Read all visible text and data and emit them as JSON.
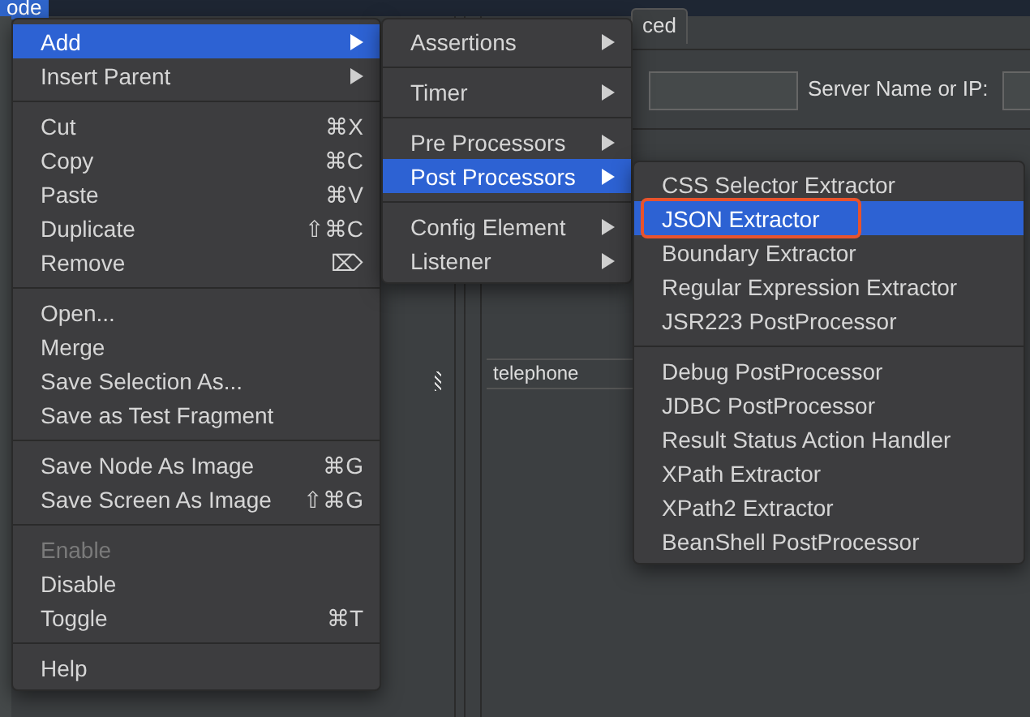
{
  "background": {
    "tree_node": "ode",
    "tab": "ced",
    "server_label": "Server Name or IP:",
    "table_cell": "telephone"
  },
  "menus": [
    {
      "items": [
        {
          "kind": "item",
          "label": "Add",
          "submenu": true,
          "selected": true,
          "disabled": false
        },
        {
          "kind": "item",
          "label": "Insert Parent",
          "submenu": true,
          "selected": false,
          "disabled": false
        },
        {
          "kind": "separator"
        },
        {
          "kind": "item",
          "label": "Cut",
          "shortcut": "⌘X",
          "selected": false,
          "disabled": false
        },
        {
          "kind": "item",
          "label": "Copy",
          "shortcut": "⌘C",
          "selected": false,
          "disabled": false
        },
        {
          "kind": "item",
          "label": "Paste",
          "shortcut": "⌘V",
          "selected": false,
          "disabled": false
        },
        {
          "kind": "item",
          "label": "Duplicate",
          "shortcut": "⇧⌘C",
          "selected": false,
          "disabled": false
        },
        {
          "kind": "item",
          "label": "Remove",
          "shortcut": "⌦",
          "selected": false,
          "disabled": false
        },
        {
          "kind": "separator"
        },
        {
          "kind": "item",
          "label": "Open...",
          "selected": false,
          "disabled": false
        },
        {
          "kind": "item",
          "label": "Merge",
          "selected": false,
          "disabled": false
        },
        {
          "kind": "item",
          "label": "Save Selection As...",
          "selected": false,
          "disabled": false
        },
        {
          "kind": "item",
          "label": "Save as Test Fragment",
          "selected": false,
          "disabled": false
        },
        {
          "kind": "separator"
        },
        {
          "kind": "item",
          "label": "Save Node As Image",
          "shortcut": "⌘G",
          "selected": false,
          "disabled": false
        },
        {
          "kind": "item",
          "label": "Save Screen As Image",
          "shortcut": "⇧⌘G",
          "selected": false,
          "disabled": false
        },
        {
          "kind": "separator"
        },
        {
          "kind": "item",
          "label": "Enable",
          "selected": false,
          "disabled": true
        },
        {
          "kind": "item",
          "label": "Disable",
          "selected": false,
          "disabled": false
        },
        {
          "kind": "item",
          "label": "Toggle",
          "shortcut": "⌘T",
          "selected": false,
          "disabled": false
        },
        {
          "kind": "separator"
        },
        {
          "kind": "item",
          "label": "Help",
          "selected": false,
          "disabled": false
        }
      ]
    },
    {
      "items": [
        {
          "kind": "item",
          "label": "Assertions",
          "submenu": true,
          "selected": false,
          "disabled": false
        },
        {
          "kind": "separator"
        },
        {
          "kind": "item",
          "label": "Timer",
          "submenu": true,
          "selected": false,
          "disabled": false
        },
        {
          "kind": "separator"
        },
        {
          "kind": "item",
          "label": "Pre Processors",
          "submenu": true,
          "selected": false,
          "disabled": false
        },
        {
          "kind": "item",
          "label": "Post Processors",
          "submenu": true,
          "selected": true,
          "disabled": false
        },
        {
          "kind": "separator"
        },
        {
          "kind": "item",
          "label": "Config Element",
          "submenu": true,
          "selected": false,
          "disabled": false
        },
        {
          "kind": "item",
          "label": "Listener",
          "submenu": true,
          "selected": false,
          "disabled": false
        }
      ]
    },
    {
      "items": [
        {
          "kind": "item",
          "label": "CSS Selector Extractor",
          "selected": false,
          "disabled": false
        },
        {
          "kind": "item",
          "label": "JSON Extractor",
          "selected": true,
          "highlighted": true,
          "disabled": false
        },
        {
          "kind": "item",
          "label": "Boundary Extractor",
          "selected": false,
          "disabled": false
        },
        {
          "kind": "item",
          "label": "Regular Expression Extractor",
          "selected": false,
          "disabled": false
        },
        {
          "kind": "item",
          "label": "JSR223 PostProcessor",
          "selected": false,
          "disabled": false
        },
        {
          "kind": "separator"
        },
        {
          "kind": "item",
          "label": "Debug PostProcessor",
          "selected": false,
          "disabled": false
        },
        {
          "kind": "item",
          "label": "JDBC PostProcessor",
          "selected": false,
          "disabled": false
        },
        {
          "kind": "item",
          "label": "Result Status Action Handler",
          "selected": false,
          "disabled": false
        },
        {
          "kind": "item",
          "label": "XPath Extractor",
          "selected": false,
          "disabled": false
        },
        {
          "kind": "item",
          "label": "XPath2 Extractor",
          "selected": false,
          "disabled": false
        },
        {
          "kind": "item",
          "label": "BeanShell PostProcessor",
          "selected": false,
          "disabled": false
        }
      ]
    }
  ]
}
